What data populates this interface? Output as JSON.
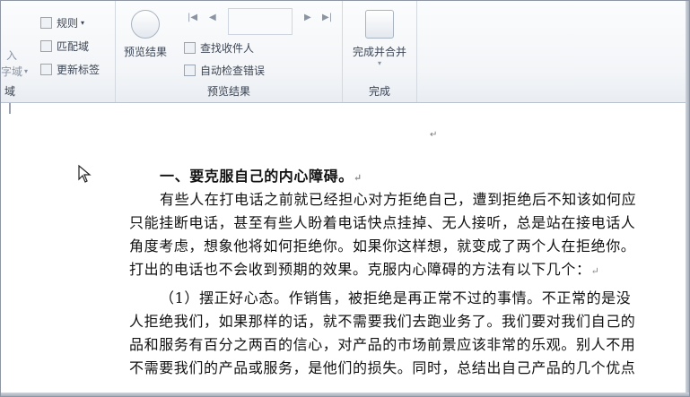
{
  "ribbon": {
    "write_insert": {
      "rules": "规则",
      "match_fields": "匹配域",
      "update_labels": "更新标签",
      "partial_1": "入",
      "partial_2": "字域",
      "partial_group": "域"
    },
    "preview": {
      "preview_results": "预览结果",
      "find_recipient": "查找收件人",
      "auto_check_errors": "自动检查错误",
      "group_label": "预览结果"
    },
    "finish": {
      "finish_merge": "完成并合并",
      "group_label": "完成"
    }
  },
  "document": {
    "paragraph_mark": "↵",
    "lines": [
      "一、要克服自己的内心障碍。",
      "有些人在打电话之前就已经担心对方拒绝自己，遭到拒绝后不知该如何应",
      "只能挂断电话，甚至有些人盼着电话快点挂掉、无人接听，总是站在接电话人",
      "角度考虑，想象他将如何拒绝你。如果你这样想，就变成了两个人在拒绝你。",
      "打出的电话也不会收到预期的效果。克服内心障碍的方法有以下几个：",
      "（1）摆正好心态。作销售，被拒绝是再正常不过的事情。不正常的是没",
      "人拒绝我们，如果那样的话，就不需要我们去跑业务了。我们要对我们自己的",
      "品和服务有百分之两百的信心，对产品的市场前景应该非常的乐观。别人不用",
      "不需要我们的产品或服务，是他们的损失。同时，总结出自己产品的几个优点"
    ]
  }
}
